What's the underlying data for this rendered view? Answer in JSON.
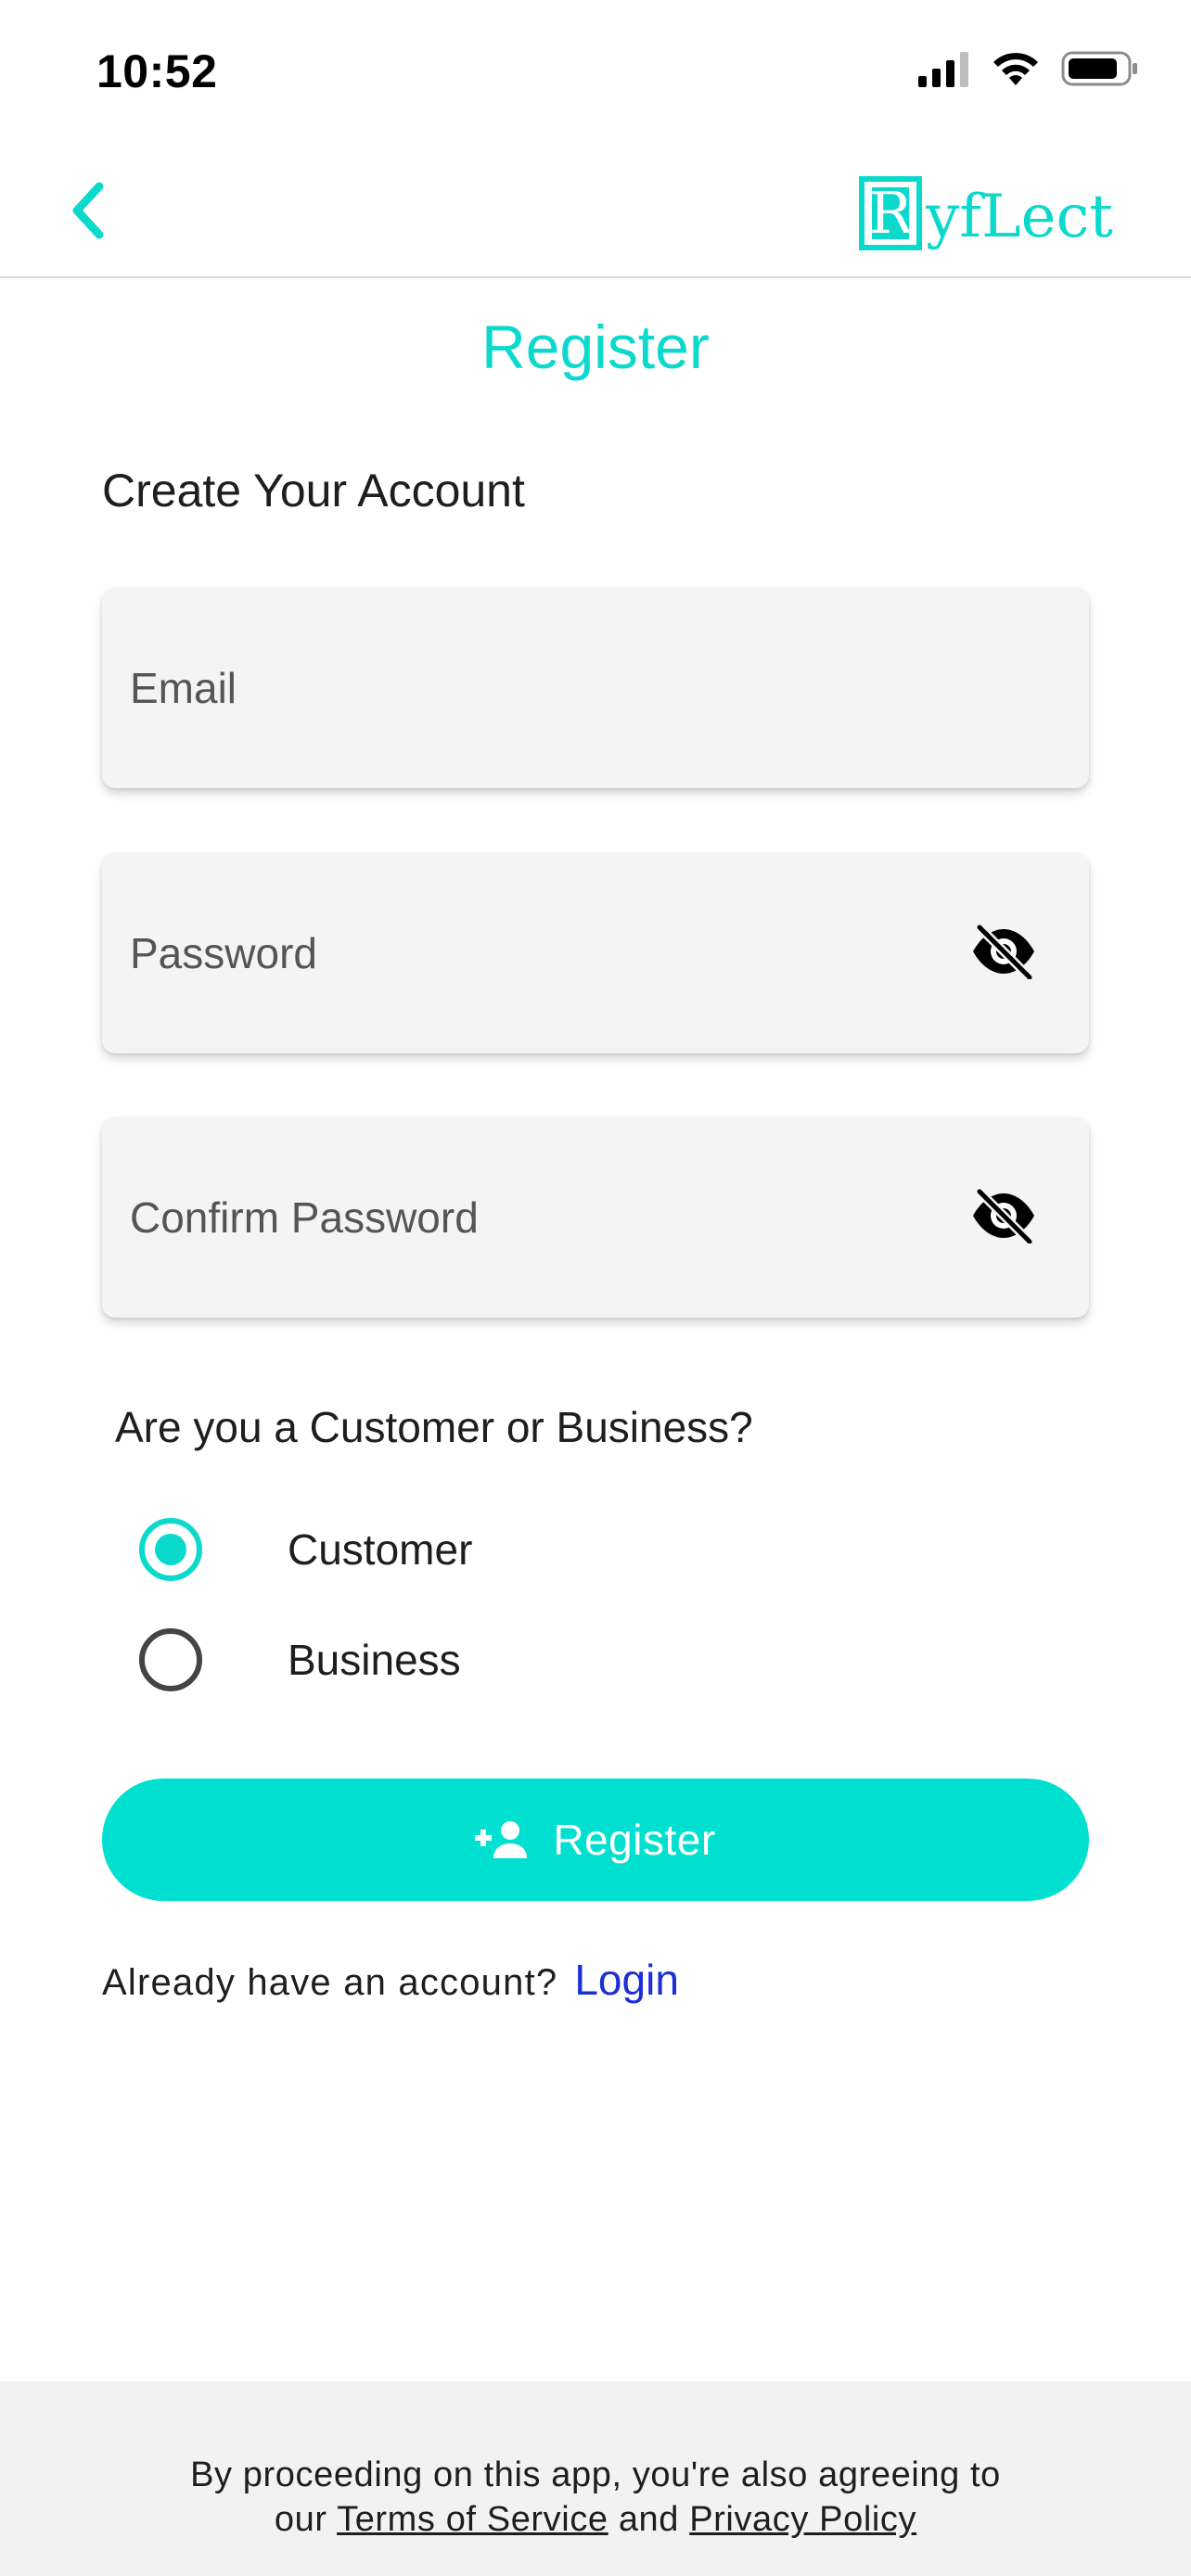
{
  "status_bar": {
    "time": "10:52",
    "icons": [
      "cellular-signal-icon",
      "wifi-icon",
      "battery-icon"
    ]
  },
  "nav": {
    "back_icon": "chevron-left-icon",
    "logo_letter": "R",
    "logo_text": "yfLect"
  },
  "page": {
    "title": "Register",
    "heading": "Create Your Account"
  },
  "form": {
    "email_placeholder": "Email",
    "password_placeholder": "Password",
    "confirm_password_placeholder": "Confirm Password",
    "visibility_icon": "eye-off-icon",
    "question": "Are you a Customer or Business?",
    "options": [
      {
        "label": "Customer",
        "selected": true
      },
      {
        "label": "Business",
        "selected": false
      }
    ],
    "register_button": {
      "label": "Register",
      "icon": "person-add-icon"
    }
  },
  "login": {
    "question": "Already have an account?",
    "link": "Login"
  },
  "footer": {
    "line1": "By proceeding on this app, you're also agreeing to",
    "line2_prefix": "our",
    "terms": "Terms of Service",
    "and": "and",
    "privacy": "Privacy Policy"
  },
  "colors": {
    "accent": "#0bd9cc",
    "button": "#00e0d0",
    "link": "#1a2fd4",
    "field_bg": "#f4f4f4",
    "footer_bg": "#f2f2f2"
  }
}
